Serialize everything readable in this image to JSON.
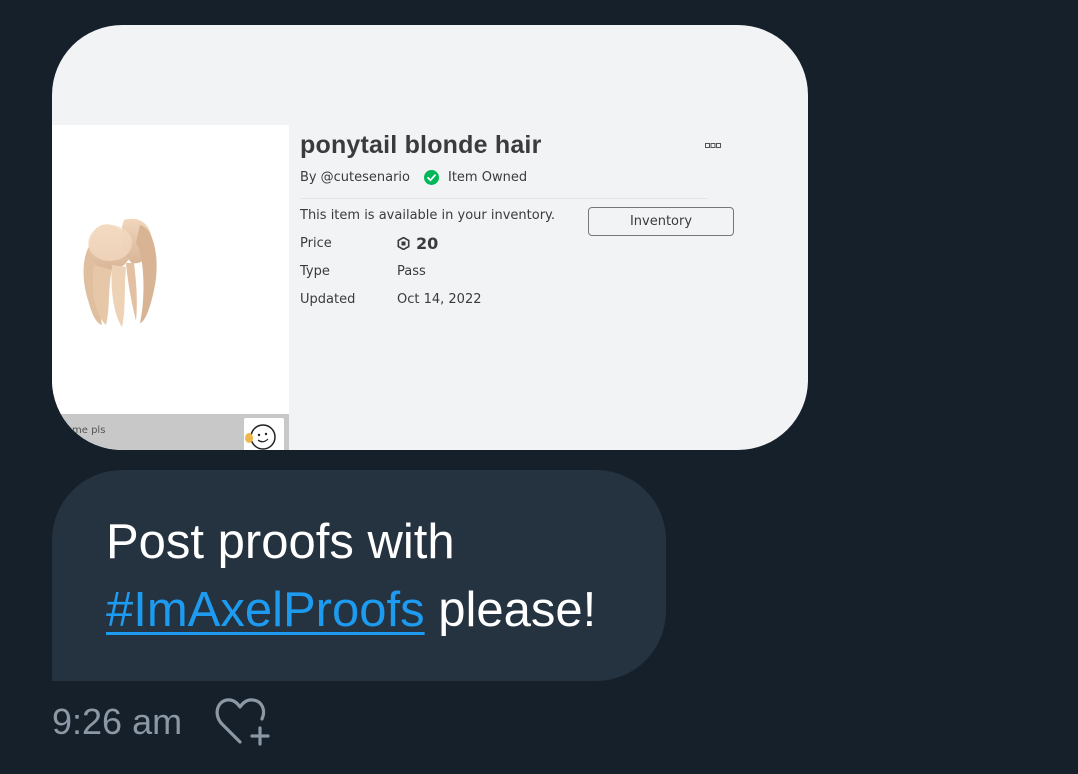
{
  "item": {
    "title": "ponytail blonde hair",
    "by_prefix": "By",
    "creator": "@cutesenario",
    "owned_label": "Item Owned",
    "availability": "This item is available in your inventory.",
    "inventory_button": "Inventory",
    "price_label": "Price",
    "price_value": "20",
    "type_label": "Type",
    "type_value": "Pass",
    "updated_label": "Updated",
    "updated_value": "Oct 14, 2022",
    "thumb_caption": "me pls"
  },
  "message": {
    "line1": "Post proofs with",
    "hashtag": "#ImAxelProofs",
    "line2_rest": " please!"
  },
  "meta": {
    "timestamp": "9:26 am"
  },
  "colors": {
    "background": "#15202b",
    "bubble": "#253341",
    "link": "#1d9bf0",
    "owned_green": "#02b757"
  }
}
